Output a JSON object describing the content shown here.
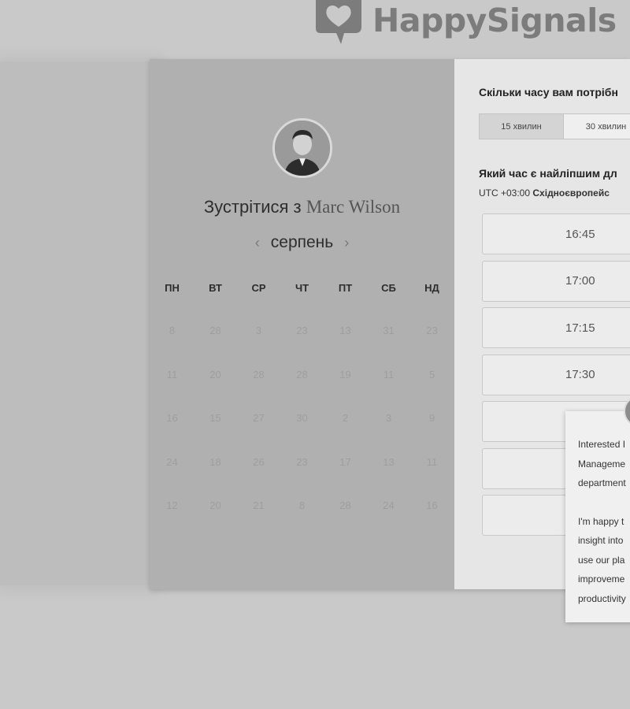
{
  "brand": {
    "name": "HappySignals"
  },
  "host": {
    "title_prefix": "Зустрітися з",
    "name": "Marc Wilson"
  },
  "calendar": {
    "month": "серпень",
    "prev_icon": "chevron-left-icon",
    "next_icon": "chevron-right-icon",
    "weekdays": [
      "ПН",
      "ВТ",
      "СР",
      "ЧТ",
      "ПТ",
      "СБ",
      "НД"
    ],
    "weeks": [
      [
        "8",
        "28",
        "3",
        "23",
        "13",
        "31",
        "23"
      ],
      [
        "11",
        "20",
        "28",
        "28",
        "19",
        "11",
        "5"
      ],
      [
        "16",
        "15",
        "27",
        "30",
        "2",
        "3",
        "9"
      ],
      [
        "24",
        "18",
        "26",
        "23",
        "17",
        "13",
        "11"
      ],
      [
        "12",
        "20",
        "21",
        "8",
        "28",
        "24",
        "16"
      ]
    ]
  },
  "booking": {
    "duration_question": "Скільки часу вам потрібн",
    "durations": [
      "15 хвилин",
      "30 хвилин"
    ],
    "time_question": "Який час є найліпшим дл",
    "timezone_offset": "UTC +03:00",
    "timezone_name": "Східноєвропейс",
    "slots": [
      "16:45",
      "17:00",
      "17:15",
      "17:30",
      "",
      "",
      ""
    ]
  },
  "chat": {
    "paragraph1": [
      "Interested I",
      "Manageme",
      "department"
    ],
    "paragraph2": [
      "I'm happy t",
      "insight into",
      "use our pla",
      "improveme",
      "productivity"
    ]
  },
  "colors": {
    "page_bg": "#c9c9c9",
    "calendar_panel": "#b0b0b0",
    "times_panel": "#e6e6e6"
  }
}
